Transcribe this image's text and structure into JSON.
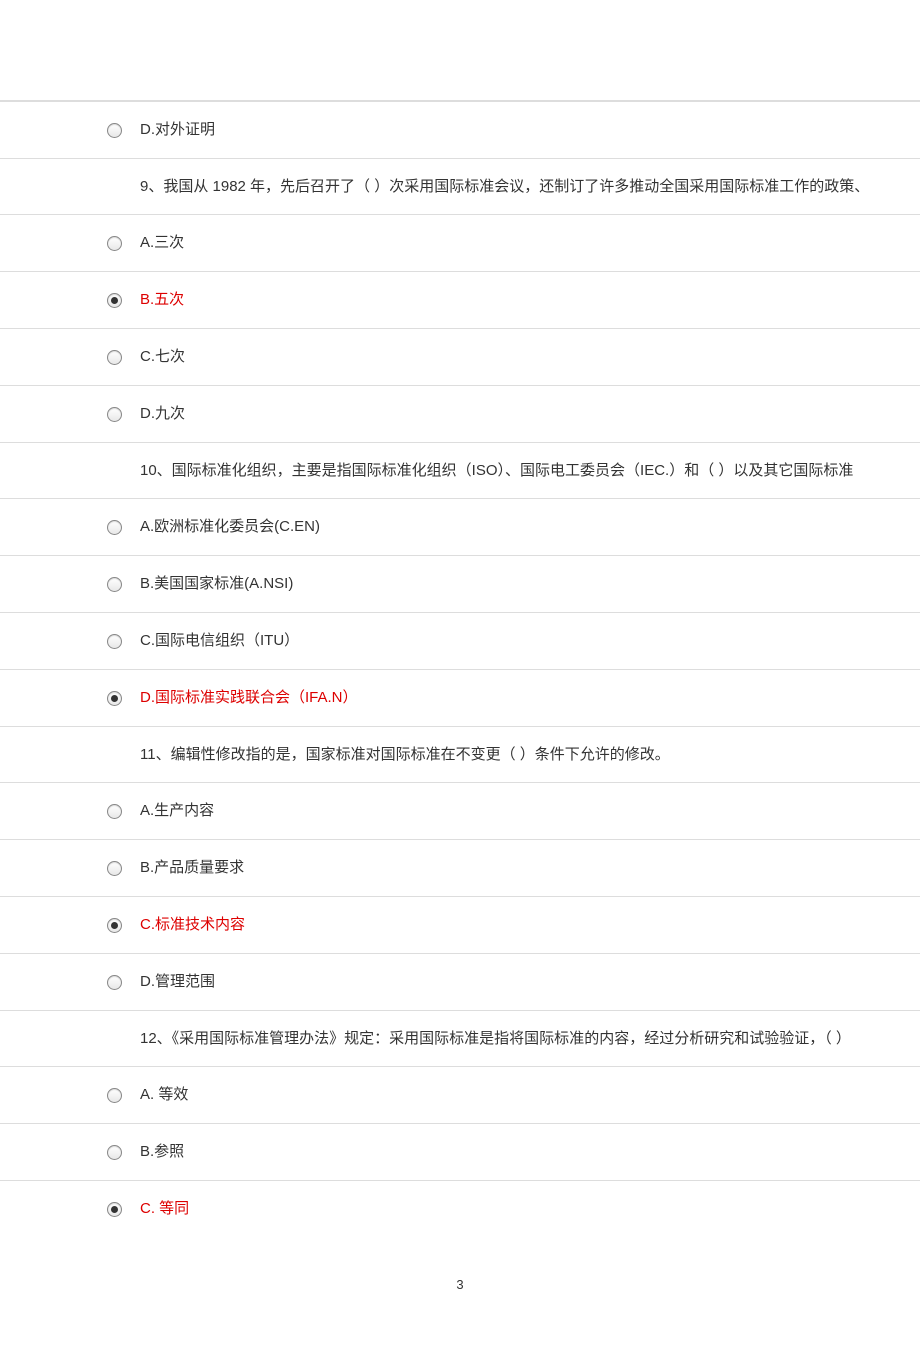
{
  "page_number": "3",
  "questions": [
    {
      "id": "q8-partial",
      "text": null,
      "options": [
        {
          "key": "D",
          "label": "D.对外证明",
          "selected": false,
          "correct": false
        }
      ]
    },
    {
      "id": "q9",
      "text": "9、我国从 1982 年，先后召开了（ ）次采用国际标准会议，还制订了许多推动全国采用国际标准工作的政策、",
      "options": [
        {
          "key": "A",
          "label": "A.三次",
          "selected": false,
          "correct": false
        },
        {
          "key": "B",
          "label": "B.五次",
          "selected": true,
          "correct": true
        },
        {
          "key": "C",
          "label": "C.七次",
          "selected": false,
          "correct": false
        },
        {
          "key": "D",
          "label": "D.九次",
          "selected": false,
          "correct": false
        }
      ]
    },
    {
      "id": "q10",
      "text": "10、国际标准化组织，主要是指国际标准化组织（ISO）、国际电工委员会（IEC.）和（ ）以及其它国际标准",
      "options": [
        {
          "key": "A",
          "label": "A.欧洲标准化委员会(C.EN)",
          "selected": false,
          "correct": false
        },
        {
          "key": "B",
          "label": "B.美国国家标准(A.NSI)",
          "selected": false,
          "correct": false
        },
        {
          "key": "C",
          "label": "C.国际电信组织（ITU）",
          "selected": false,
          "correct": false
        },
        {
          "key": "D",
          "label": "D.国际标准实践联合会（IFA.N）",
          "selected": true,
          "correct": true
        }
      ]
    },
    {
      "id": "q11",
      "text": "11、编辑性修改指的是，国家标准对国际标准在不变更（ ）条件下允许的修改。",
      "options": [
        {
          "key": "A",
          "label": "A.生产内容",
          "selected": false,
          "correct": false
        },
        {
          "key": "B",
          "label": "B.产品质量要求",
          "selected": false,
          "correct": false
        },
        {
          "key": "C",
          "label": "C.标准技术内容",
          "selected": true,
          "correct": true
        },
        {
          "key": "D",
          "label": "D.管理范围",
          "selected": false,
          "correct": false
        }
      ]
    },
    {
      "id": "q12",
      "text": "12、《采用国际标准管理办法》规定：采用国际标准是指将国际标准的内容，经过分析研究和试验验证，（ ）",
      "options": [
        {
          "key": "A",
          "label": "A.  等效",
          "selected": false,
          "correct": false
        },
        {
          "key": "B",
          "label": "B.参照",
          "selected": false,
          "correct": false
        },
        {
          "key": "C",
          "label": "C.  等同",
          "selected": true,
          "correct": true
        }
      ]
    }
  ]
}
